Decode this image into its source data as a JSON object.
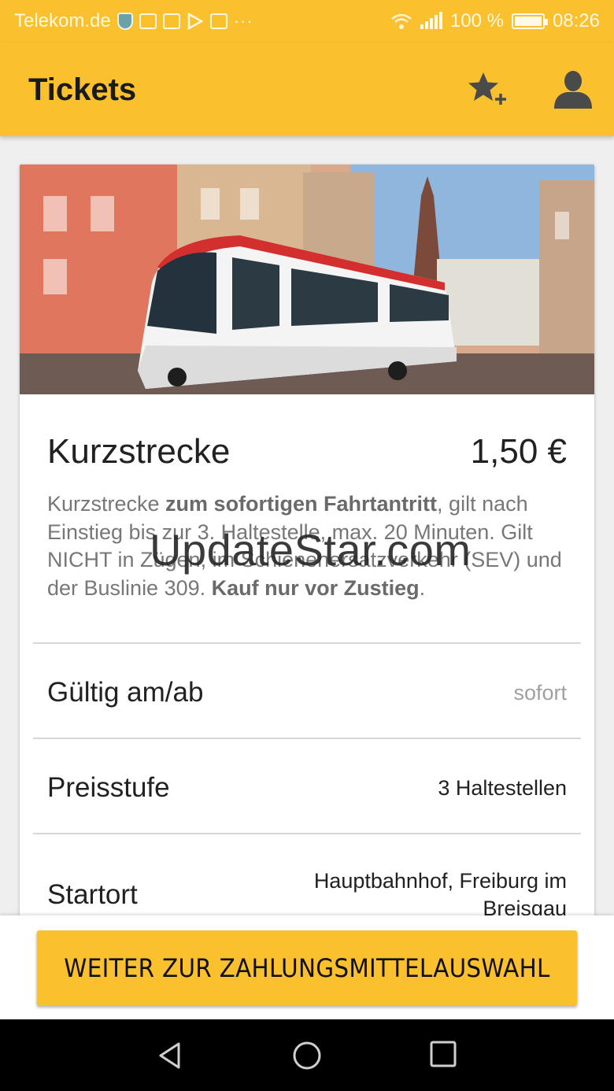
{
  "status_bar": {
    "carrier": "Telekom.de",
    "more": "···",
    "battery_percent": "100 %",
    "battery_level": 1.0,
    "time": "08:26"
  },
  "app_bar": {
    "title": "Tickets",
    "icons": [
      "star-add-icon",
      "user-icon"
    ]
  },
  "ticket": {
    "name": "Kurzstrecke",
    "price": "1,50 €",
    "description": {
      "p1": "Kurzstrecke ",
      "b1": "zum sofortigen Fahrtantritt",
      "p2": ", gilt nach Einstieg bis zur 3. Haltestelle, max. 20 Minuten. Gilt NICHT in Zügen, im Schienenersatzverkehr (SEV) und der Buslinie 309. ",
      "b2": "Kauf nur vor Zustieg",
      "p3": "."
    },
    "rows": [
      {
        "label": "Gültig am/ab",
        "value": "sofort"
      },
      {
        "label": "Preisstufe",
        "value": "3 Haltestellen"
      },
      {
        "label": "Startort",
        "value_line1": "Hauptbahnhof, Freiburg im",
        "value_line2": "Breisgau"
      }
    ]
  },
  "watermark": "UpdateStar.com",
  "cta": {
    "label": "WEITER ZUR ZAHLUNGSMITTELAUSWAHL"
  },
  "nav": {
    "icons": [
      "back-icon",
      "home-icon",
      "recents-icon"
    ]
  },
  "colors": {
    "accent": "#fbc02d",
    "text": "#212121",
    "muted": "#777777",
    "tram_red": "#d32f2f"
  }
}
